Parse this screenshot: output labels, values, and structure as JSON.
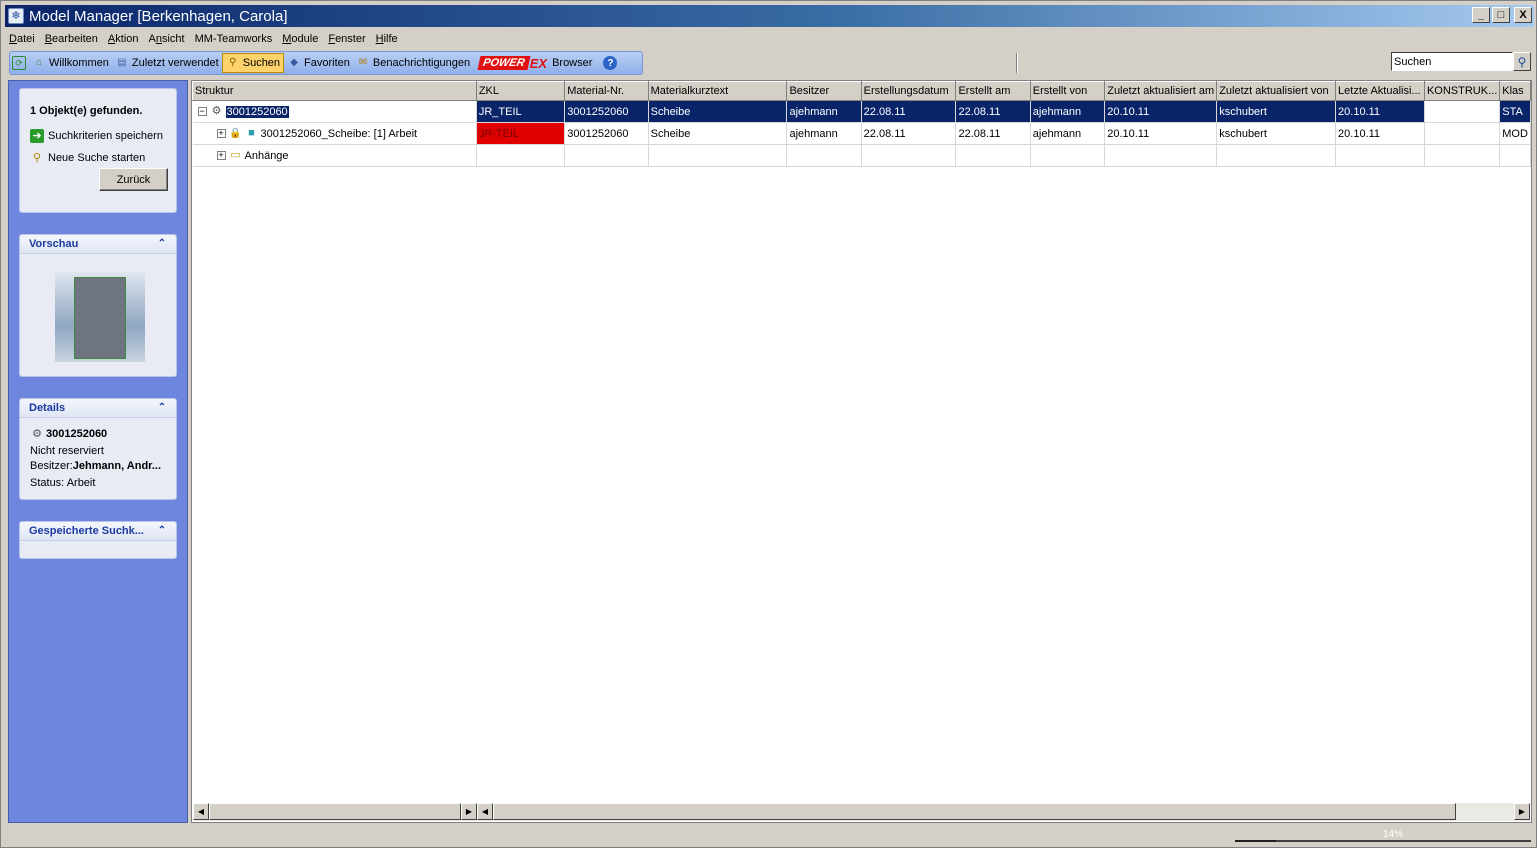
{
  "window": {
    "title": "Model Manager [Berkenhagen, Carola]",
    "minimize": "_",
    "maximize": "□",
    "close": "X"
  },
  "menu": [
    {
      "label": "Datei",
      "u": "D",
      "rest": "atei"
    },
    {
      "label": "Bearbeiten",
      "u": "B",
      "rest": "earbeiten"
    },
    {
      "label": "Aktion",
      "u": "A",
      "rest": "ktion"
    },
    {
      "label": "Ansicht",
      "u": "n",
      "pre": "A",
      "rest": "sicht"
    },
    {
      "label": "MM-Teamworks",
      "u": "",
      "pre": "MM-Teamworks",
      "rest": ""
    },
    {
      "label": "Module",
      "u": "M",
      "rest": "odule"
    },
    {
      "label": "Fenster",
      "u": "F",
      "rest": "enster"
    },
    {
      "label": "Hilfe",
      "u": "H",
      "rest": "ilfe"
    }
  ],
  "toolbar": {
    "willkommen": "Willkommen",
    "zuletzt": "Zuletzt verwendet",
    "suchen": "Suchen",
    "favoriten": "Favoriten",
    "benachrichtigungen": "Benachrichtigungen",
    "power": "POWER",
    "ex": "EX",
    "browser": "Browser",
    "help": "?"
  },
  "search": {
    "value": "Suchen"
  },
  "left": {
    "found": "1 Objekt(e) gefunden.",
    "save_criteria": "Suchkriterien speichern",
    "new_search": "Neue Suche starten",
    "back": "Zurück",
    "preview_title": "Vorschau",
    "details_title": "Details",
    "details_id": "3001252060",
    "details_reserved": "Nicht reserviert",
    "details_owner_label": "Besitzer:",
    "details_owner": "Jehmann, Andr...",
    "details_status": "Status: Arbeit",
    "saved_title": "Gespeicherte Suchk..."
  },
  "table": {
    "columns": [
      "Struktur",
      "ZKL",
      "Material-Nr.",
      "Materialkurztext",
      "Besitzer",
      "Erstellungsdatum",
      "Erstellt am",
      "Erstellt von",
      "Zuletzt aktualisiert am",
      "Zuletzt aktualisiert von",
      "Letzte Aktualisi...",
      "KONSTRUK...",
      "Klas"
    ],
    "rows": [
      {
        "struktur": "3001252060",
        "zkl": "JR_TEIL",
        "material_nr": "3001252060",
        "kurztext": "Scheibe",
        "besitzer": "ajehmann",
        "erstellungsdatum": "22.08.11",
        "erstellt_am": "22.08.11",
        "erstellt_von": "ajehmann",
        "aktualisiert_am": "20.10.11",
        "aktualisiert_von": "kschubert",
        "letzte": "20.10.11",
        "konstruk": "",
        "klas": "STA"
      },
      {
        "struktur": "3001252060_Scheibe: [1] Arbeit",
        "zkl": "JR-TEIL",
        "material_nr": "3001252060",
        "kurztext": "Scheibe",
        "besitzer": "ajehmann",
        "erstellungsdatum": "22.08.11",
        "erstellt_am": "22.08.11",
        "erstellt_von": "ajehmann",
        "aktualisiert_am": "20.10.11",
        "aktualisiert_von": "kschubert",
        "letzte": "20.10.11",
        "konstruk": "",
        "klas": "MOD"
      },
      {
        "struktur": "Anhänge",
        "zkl": "",
        "material_nr": "",
        "kurztext": "",
        "besitzer": "",
        "erstellungsdatum": "",
        "erstellt_am": "",
        "erstellt_von": "",
        "aktualisiert_am": "",
        "aktualisiert_von": "",
        "letzte": "",
        "konstruk": "",
        "klas": ""
      }
    ]
  },
  "status": {
    "progress_text": "14%",
    "progress": 0.14
  },
  "colors": {
    "selection": "#0a246a",
    "zkl_red": "#e00000",
    "sidebar": "#6f86de"
  }
}
